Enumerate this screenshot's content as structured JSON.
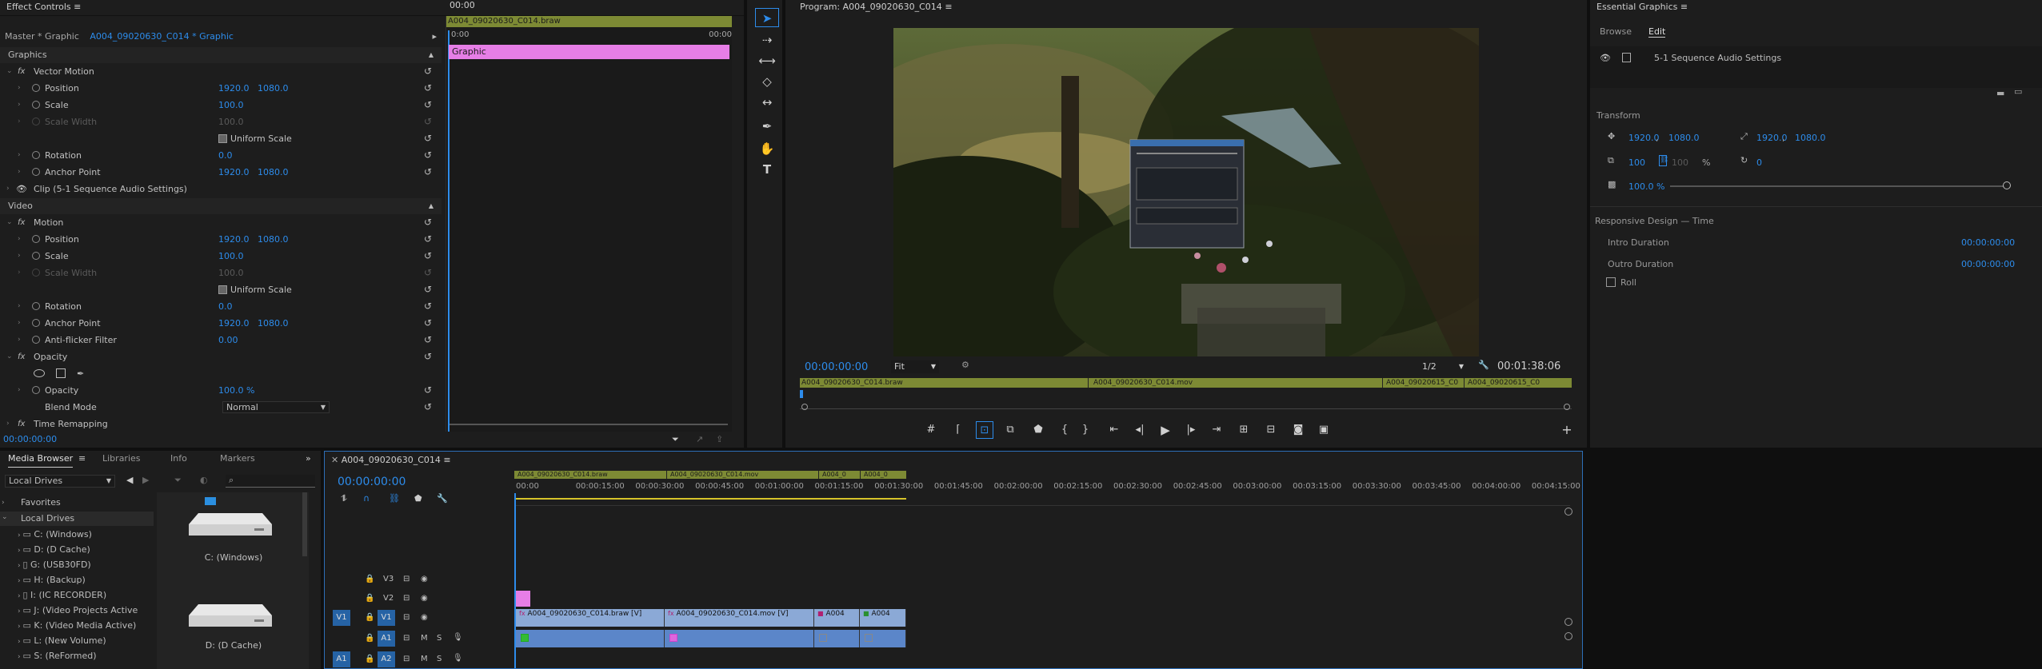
{
  "effect_controls": {
    "tab": "Effect Controls",
    "master": "Master * Graphic",
    "clip_tab": "A004_09020630_C014 * Graphic",
    "graphics_label": "Graphics",
    "vector_motion": "Vector Motion",
    "video_label": "Video",
    "motion": "Motion",
    "opacity": "Opacity",
    "time_remapping": "Time Remapping",
    "clip_audio": "Clip (5-1 Sequence Audio Settings)",
    "position_label": "Position",
    "scale_label": "Scale",
    "scale_width_label": "Scale Width",
    "uniform_scale": "Uniform Scale",
    "rotation_label": "Rotation",
    "anchor_label": "Anchor Point",
    "antiflicker_label": "Anti-flicker Filter",
    "opacity_label": "Opacity",
    "blend_label": "Blend Mode",
    "vm": {
      "pos_x": "1920.0",
      "pos_y": "1080.0",
      "scale": "100.0",
      "scale_width": "100.0",
      "rotation": "0.0",
      "anchor_x": "1920.0",
      "anchor_y": "1080.0"
    },
    "motion_vals": {
      "pos_x": "1920.0",
      "pos_y": "1080.0",
      "scale": "100.0",
      "scale_width": "100.0",
      "rotation": "0.0",
      "anchor_x": "1920.0",
      "anchor_y": "1080.0",
      "antiflicker": "0.00"
    },
    "opacity_value": "100.0 %",
    "blend_mode": "Normal",
    "timecode": "00:00:00:00",
    "mini_clip": "A004_09020630_C014.braw",
    "mini_t0": "0:00",
    "mini_t1": "00:00",
    "mini_t2": "00:00",
    "graphic_bar": "Graphic"
  },
  "program": {
    "title": "Program: A004_09020630_C014",
    "timecode": "00:00:00:00",
    "fit": "Fit",
    "ratio": "1/2",
    "duration": "00:01:38:06",
    "clips": [
      "A004_09020630_C014.braw",
      "A004_09020630_C014.mov",
      "A004_09020615_C0",
      "A004_09020615_C0"
    ]
  },
  "essential_graphics": {
    "title": "Essential Graphics",
    "tabs": [
      "Browse",
      "Edit"
    ],
    "layer": "5-1 Sequence Audio Settings",
    "transform": "Transform",
    "pos_x": "1920.0",
    "pos_y": "1080.0",
    "anchor_x": "1920.0",
    "anchor_y": "1080.0",
    "scale": "100",
    "scale_h": "100",
    "pct": "%",
    "rotation": "0",
    "opacity": "100.0 %",
    "responsive": "Responsive Design — Time",
    "intro_label": "Intro Duration",
    "intro_val": "00:00:00:00",
    "outro_label": "Outro Duration",
    "outro_val": "00:00:00:00",
    "roll": "Roll"
  },
  "media_browser": {
    "tabs": [
      "Media Browser",
      "Libraries",
      "Info",
      "Markers"
    ],
    "location": "Local Drives",
    "favorites": "Favorites",
    "local_drives": "Local Drives",
    "drives": [
      "C: (Windows)",
      "D: (D Cache)",
      "G: (USB30FD)",
      "H: (Backup)",
      "I: (IC RECORDER)",
      "J: (Video Projects Active",
      "K: (Video Media Active)",
      "L: (New Volume)",
      "S: (ReFormed)"
    ],
    "thumbs": [
      "C: (Windows)",
      "D: (D Cache)"
    ]
  },
  "timeline": {
    "title": "A004_09020630_C014",
    "timecode": "00:00:00:00",
    "ticks": [
      "00:00",
      "00:00:15:00",
      "00:00:30:00",
      "00:00:45:00",
      "00:01:00:00",
      "00:01:15:00",
      "00:01:30:00",
      "00:01:45:00",
      "00:02:00:00",
      "00:02:15:00",
      "00:02:30:00",
      "00:02:45:00",
      "00:03:00:00",
      "00:03:15:00",
      "00:03:30:00",
      "00:03:45:00",
      "00:04:00:00",
      "00:04:15:00"
    ],
    "tracks": [
      "V3",
      "V2",
      "V1",
      "A1",
      "A2"
    ],
    "source_v": "V1",
    "source_a": "A1",
    "mini_clips": [
      "A004_09020630_C014.braw",
      "A004_09020630_C014.mov",
      "A004_0",
      "A004_0"
    ],
    "v1_clips": [
      "A004_09020630_C014.braw [V]",
      "A004_09020630_C014.mov [V]",
      "A004",
      "A004"
    ],
    "m_label": "M",
    "s_label": "S"
  },
  "colors": {
    "accent": "#2d8ceb",
    "graphic": "#e67ee6",
    "clip_video": "#8ba9d6",
    "clip_audio": "#5b86c9",
    "bar": "#7d8a34"
  }
}
